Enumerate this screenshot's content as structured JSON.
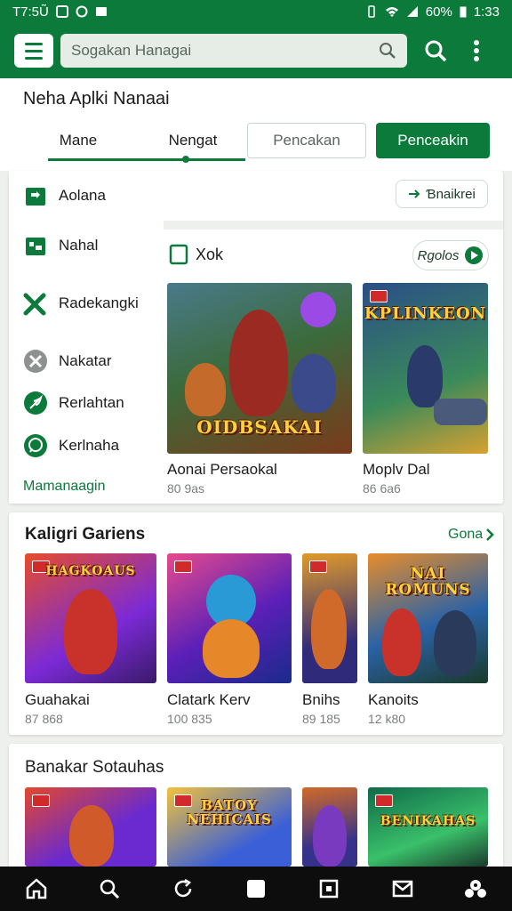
{
  "status": {
    "left_text": "T7:5Ũ",
    "battery": "60%",
    "time": "1:33"
  },
  "search": {
    "placeholder": "Sogakan Hanagai"
  },
  "page_title": "Neha Aplki Nanaai",
  "tabs": [
    "Mane",
    "Nengat",
    "Pencakan",
    "Penceakin"
  ],
  "sidebar": {
    "items": [
      {
        "label": "Aolana",
        "icon": "app-box-icon"
      },
      {
        "label": "Nahal",
        "icon": "grid-app-icon"
      },
      {
        "label": "Radekangki",
        "icon": "tools-icon"
      },
      {
        "label": "Nakatar",
        "icon": "blocked-icon"
      },
      {
        "label": "Rerlahtan",
        "icon": "leaf-icon"
      },
      {
        "label": "Kerlnaha",
        "icon": "chat-icon"
      }
    ],
    "more": "Mamanaagin"
  },
  "top_action": {
    "label": "Ɓnaikrei"
  },
  "featured": {
    "title": "Xok",
    "action": "Rgolos",
    "games": [
      {
        "name": "Aonai Persaokal",
        "size": "80 9as",
        "logo": "OIDBSAKAI",
        "colors": [
          "#3b6b3c",
          "#c94d2a"
        ]
      },
      {
        "name": "Moplv Dal",
        "size": "86 6a6",
        "logo": "KPLINKEON",
        "colors": [
          "#2a4e86",
          "#d8a132"
        ]
      }
    ]
  },
  "categories": {
    "title": "Kaligri Gariens",
    "link": "Gona",
    "games": [
      {
        "name": "Guahakai",
        "size": "87 868",
        "logo": "HAGKOAUS",
        "colors": [
          "#7c2ad6",
          "#e64d2a"
        ]
      },
      {
        "name": "Clatark Kerv",
        "size": "100 835",
        "logo": "",
        "colors": [
          "#5b1fb8",
          "#e64a8c"
        ]
      },
      {
        "name": "Bnihs",
        "size": "89 185",
        "logo": "",
        "colors": [
          "#2f2a7a",
          "#e09a2a"
        ]
      },
      {
        "name": "Kanoits",
        "size": "12 k80",
        "logo": "NAI ROMUNS",
        "colors": [
          "#2a62a6",
          "#e88d2a"
        ]
      }
    ]
  },
  "recommended": {
    "title": "Banakar Sotauhas",
    "games": [
      {
        "logo": "",
        "colors": [
          "#6a2ad0",
          "#e4482a"
        ]
      },
      {
        "logo": "BATOY NEHICAIS",
        "colors": [
          "#3a5fd6",
          "#f2c23a"
        ]
      },
      {
        "logo": "",
        "colors": [
          "#36328a",
          "#d06a2a"
        ]
      },
      {
        "logo": "BENIKAHAS",
        "colors": [
          "#0f6a4a",
          "#3ac06a"
        ]
      }
    ]
  },
  "bottom_nav": [
    "home-icon",
    "search-icon",
    "refresh-icon",
    "square-icon",
    "apps-icon",
    "mail-icon",
    "profile-icon"
  ],
  "colors": {
    "primary": "#0b7a3b",
    "background": "#eef0ee"
  }
}
